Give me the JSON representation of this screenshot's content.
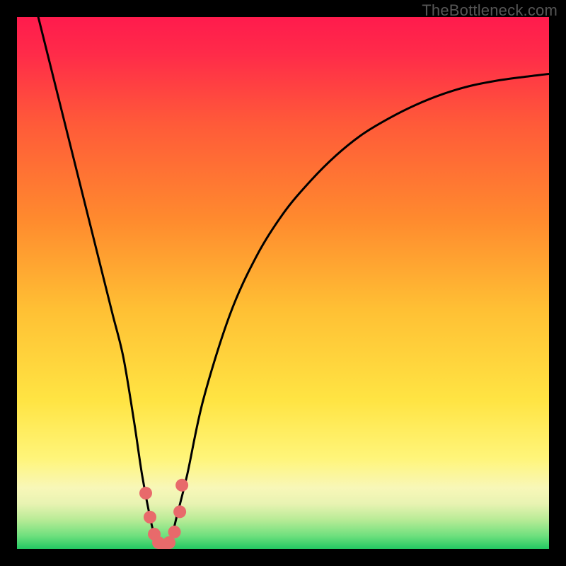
{
  "watermark": "TheBottleneck.com",
  "colors": {
    "gradient_top": "#ff1b4d",
    "gradient_mid_orange": "#ff7a2e",
    "gradient_yellow": "#ffe443",
    "gradient_pale": "#f8f7b8",
    "gradient_green": "#2bd66a",
    "curve": "#000000",
    "marker": "#e86a6b"
  },
  "chart_data": {
    "type": "line",
    "title": "",
    "xlabel": "",
    "ylabel": "",
    "xlim": [
      0,
      100
    ],
    "ylim": [
      0,
      100
    ],
    "series": [
      {
        "name": "bottleneck-curve",
        "x": [
          4,
          6,
          8,
          10,
          12,
          14,
          16,
          18,
          20,
          22,
          23.5,
          25,
          26,
          27,
          28,
          29,
          30,
          32,
          35,
          40,
          45,
          50,
          55,
          60,
          65,
          70,
          75,
          80,
          85,
          90,
          95,
          100
        ],
        "values": [
          100,
          92,
          84,
          76,
          68,
          60,
          52,
          44,
          36,
          24,
          14,
          6,
          2,
          0,
          0,
          2,
          6,
          14,
          28,
          44,
          55,
          63,
          69,
          74,
          78,
          81,
          83.5,
          85.5,
          87,
          88,
          88.7,
          89.3
        ]
      }
    ],
    "markers": {
      "name": "highlight-points",
      "x": [
        24.2,
        25.0,
        25.8,
        26.6,
        27.6,
        28.6,
        29.6,
        30.6,
        31.0
      ],
      "values": [
        10.5,
        6.0,
        2.8,
        1.2,
        0.4,
        1.2,
        3.2,
        7.0,
        12.0
      ]
    }
  }
}
